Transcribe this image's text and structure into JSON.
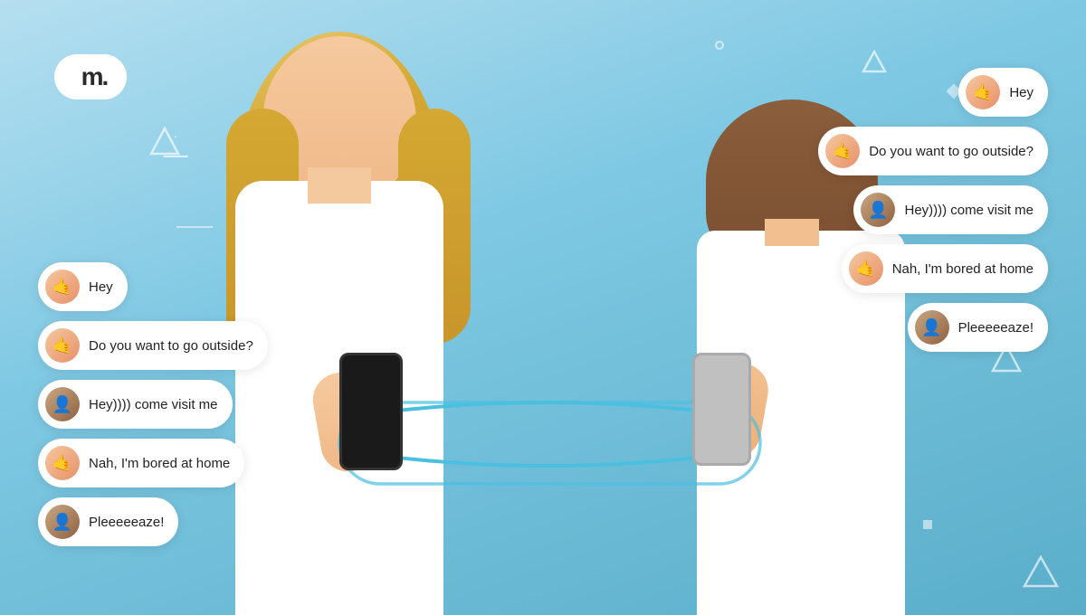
{
  "logo": {
    "text": "m."
  },
  "left_bubbles": [
    {
      "id": "lb1",
      "text": "Hey",
      "avatar_emoji": "🤙",
      "avatar_type": "girl"
    },
    {
      "id": "lb2",
      "text": "Do you want to go outside?",
      "avatar_emoji": "🤙",
      "avatar_type": "girl"
    },
    {
      "id": "lb3",
      "text": "Hey)))) come visit me",
      "avatar_emoji": "👤",
      "avatar_type": "boy"
    },
    {
      "id": "lb4",
      "text": "Nah, I'm bored at home",
      "avatar_emoji": "🤙",
      "avatar_type": "girl"
    },
    {
      "id": "lb5",
      "text": "Pleeeeeaze!",
      "avatar_emoji": "👤",
      "avatar_type": "boy"
    }
  ],
  "right_bubbles": [
    {
      "id": "rb1",
      "text": "Hey",
      "avatar_emoji": "🤙",
      "avatar_type": "girl"
    },
    {
      "id": "rb2",
      "text": "Do you want to go outside?",
      "avatar_emoji": "🤙",
      "avatar_type": "girl"
    },
    {
      "id": "rb3",
      "text": "Hey)))) come visit me",
      "avatar_emoji": "👤",
      "avatar_type": "boy2"
    },
    {
      "id": "rb4",
      "text": "Nah, I'm bored at home",
      "avatar_emoji": "🤙",
      "avatar_type": "girl"
    },
    {
      "id": "rb5",
      "text": "Pleeeeeaze!",
      "avatar_emoji": "👤",
      "avatar_type": "boy2"
    }
  ],
  "colors": {
    "background": "#7ec8e3",
    "bubble_bg": "#ffffff",
    "arrow_color": "#4bbfe0",
    "text_color": "#222222"
  }
}
